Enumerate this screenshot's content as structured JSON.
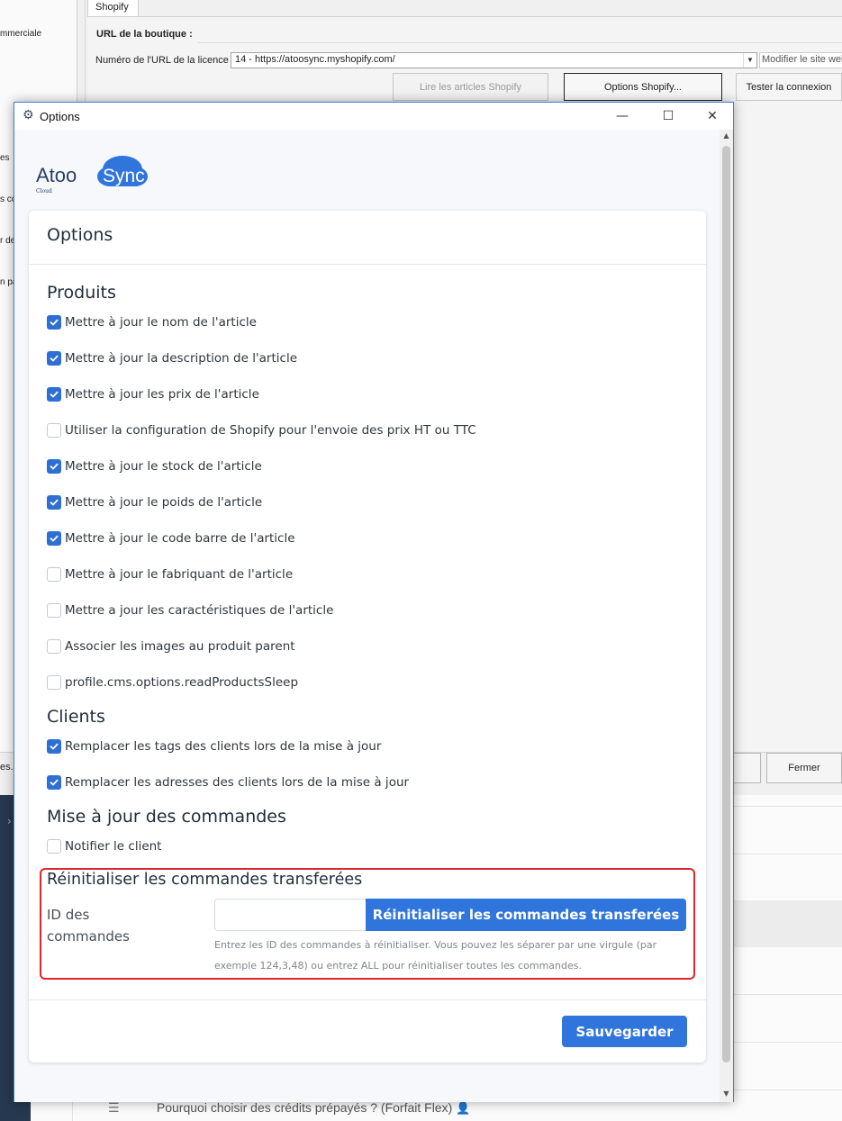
{
  "background": {
    "left_texts": [
      "mmerciale",
      "es",
      "s co",
      "r de",
      "n pa"
    ],
    "tab_label": "Shopify",
    "section_label": "URL de la boutique :",
    "license_label": "Numéro de l'URL de la licence :",
    "license_value": "14 - https://atoosync.myshopify.com/",
    "edit_site_label": "Modifier le site web",
    "read_articles_button": "Lire les articles Shopify",
    "options_button": "Options Shopify...",
    "test_connection_button": "Tester la connexion",
    "bottom_left_text": "es.",
    "close_button": "Fermer",
    "faq_text": "Pourquoi choisir des crédits prépayés ? (Forfait Flex)"
  },
  "dialog": {
    "title": "Options",
    "logo_main": "Atoo",
    "logo_accent": "Sync",
    "logo_sub": "Cloud",
    "card_title": "Options",
    "sections": {
      "produits": {
        "title": "Produits",
        "items": [
          {
            "label": "Mettre à jour le nom de l'article",
            "checked": true
          },
          {
            "label": "Mettre à jour la description de l'article",
            "checked": true
          },
          {
            "label": "Mettre à jour les prix de l'article",
            "checked": true
          },
          {
            "label": "Utiliser la configuration de Shopify pour l'envoie des prix HT ou TTC",
            "checked": false
          },
          {
            "label": "Mettre à jour le stock de l'article",
            "checked": true
          },
          {
            "label": "Mettre à jour le poids de l'article",
            "checked": true
          },
          {
            "label": "Mettre à jour le code barre de l'article",
            "checked": true
          },
          {
            "label": "Mettre à jour le fabriquant de l'article",
            "checked": false
          },
          {
            "label": "Mettre a jour les caractéristiques de l'article",
            "checked": false
          },
          {
            "label": "Associer les images au produit parent",
            "checked": false
          },
          {
            "label": "profile.cms.options.readProductsSleep",
            "checked": false
          }
        ]
      },
      "clients": {
        "title": "Clients",
        "items": [
          {
            "label": "Remplacer les tags des clients lors de la mise à jour",
            "checked": true
          },
          {
            "label": "Remplacer les adresses des clients lors de la mise à jour",
            "checked": true
          }
        ]
      },
      "commandes": {
        "title": "Mise à jour des commandes",
        "items": [
          {
            "label": "Notifier le client",
            "checked": false
          }
        ]
      },
      "reset": {
        "title": "Réinitialiser les commandes transferées",
        "id_label": "ID des commandes",
        "input_value": "",
        "button_label": "Réinitialiser les commandes transferées",
        "help_line1": "Entrez les ID des commandes à réinitialiser. Vous pouvez les séparer par une virgule (par",
        "help_line2": "exemple 124,3,48) ou entrez ALL pour réinitialiser toutes les commandes."
      }
    },
    "save_button": "Sauvegarder"
  },
  "colors": {
    "accent": "#2f75dc",
    "checkbox": "#2f6fd4",
    "highlight_border": "#e0262c",
    "sidebar_dark": "#26384f"
  }
}
